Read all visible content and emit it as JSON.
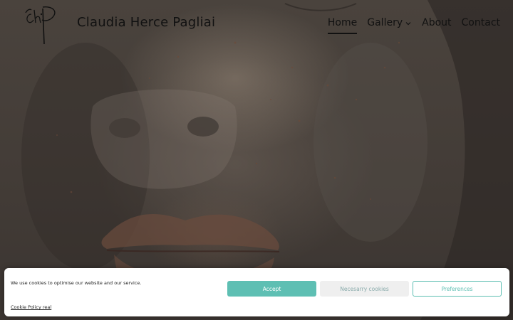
{
  "header": {
    "logo_icon": "ch-signature-logo-icon",
    "site_title": "Claudia Herce Pagliai"
  },
  "nav": {
    "items": [
      {
        "label": "Home",
        "active": true
      },
      {
        "label": "Gallery",
        "has_dropdown": true,
        "dropdown_icon": "chevron-down-icon"
      },
      {
        "label": "About"
      },
      {
        "label": "Contact"
      }
    ]
  },
  "hero": {
    "image": "sculpted-face-closeup"
  },
  "cookie_banner": {
    "message": "We use cookies to optimise our website and our service.",
    "policy_link": "Cookie Policy real",
    "buttons": {
      "accept": "Accept",
      "necessary": "Necesarry cookies",
      "preferences": "Preferences"
    },
    "accent_color": "#5ebfb3"
  }
}
